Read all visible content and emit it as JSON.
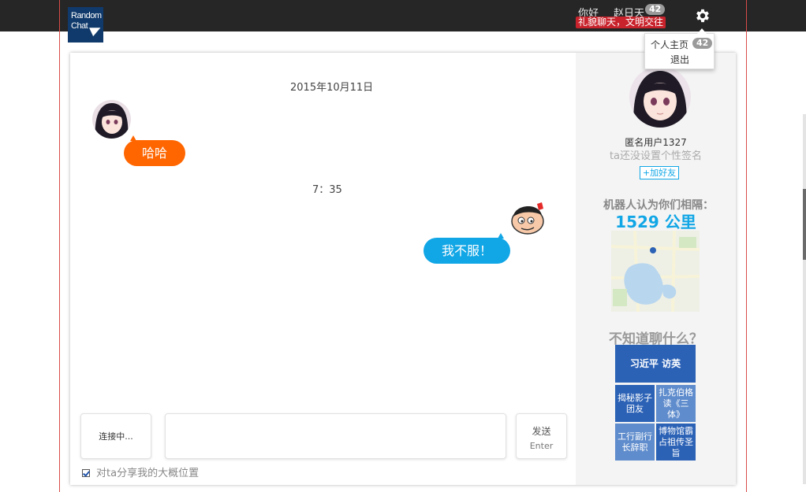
{
  "header": {
    "logo_line1": "Random",
    "logo_line2": "Chat",
    "greeting": "你好",
    "username": "赵日天",
    "badge_count": "42",
    "notice": "礼貌聊天，文明交往"
  },
  "user_menu": {
    "home_label": "个人主页",
    "home_badge": "42",
    "logout_label": "退出"
  },
  "chat": {
    "date": "2015年10月11日",
    "messages": [
      {
        "from": "stranger",
        "text": "哈哈"
      },
      {
        "from": "me",
        "text": "我不服！"
      }
    ],
    "time_separator": "7：35"
  },
  "composer": {
    "status_label": "连接中...",
    "input_value": "",
    "send_label": "发送",
    "send_hint": "Enter",
    "share_location_label": "对ta分享我的大概位置",
    "share_location_checked": true
  },
  "profile": {
    "name": "匿名用户1327",
    "signature": "ta还没设置个性签名",
    "add_friend_label": "+加好友",
    "robot_label": "机器人认为你们相隔：",
    "distance": "1529 公里"
  },
  "topics": {
    "title": "不知道聊什么？",
    "items": [
      "习近平 访英",
      "揭秘影子团友",
      "扎克伯格读《三体》",
      "工行副行长辞职",
      "博物馆霸占祖传圣旨"
    ]
  },
  "colors": {
    "topbar": "#262626",
    "accent_blue": "#11a6e6",
    "accent_orange": "#ff6600",
    "notice_red": "#c8232c",
    "tile_blue": "#2c62b6"
  }
}
